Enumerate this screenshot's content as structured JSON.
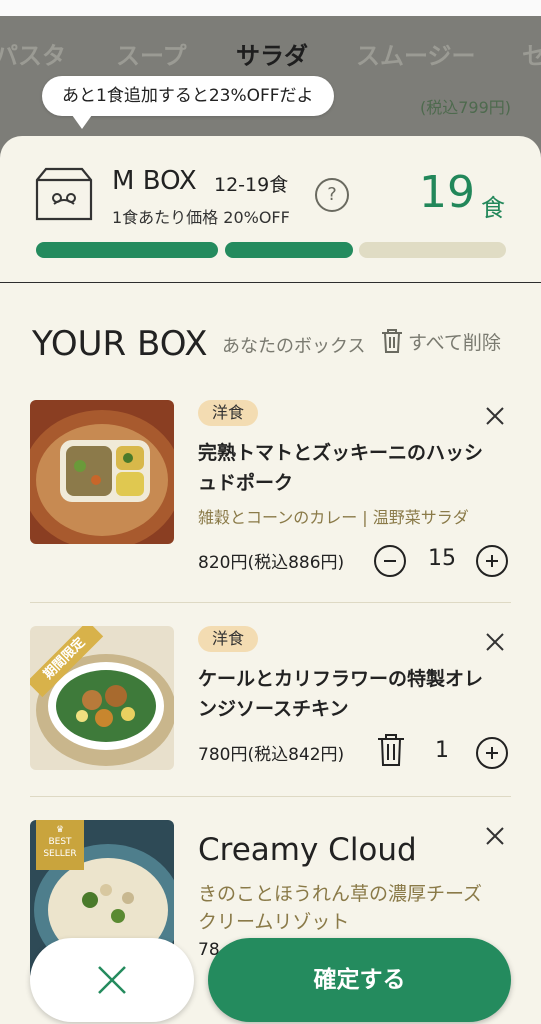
{
  "tabs": [
    "パスタ",
    "スープ",
    "サラダ",
    "スムージー",
    "セ"
  ],
  "bg_price": "(税込799円)",
  "tooltip": "あと1食追加すると23%OFFだよ",
  "box": {
    "name": "M BOX",
    "range": "12-19食",
    "discount": "1食あたり価格 20%OFF",
    "help": "?",
    "count": "19",
    "count_unit": "食",
    "progress_fraction": 0.67
  },
  "your_box": {
    "title": "YOUR BOX",
    "subtitle": "あなたのボックス",
    "delete_all": "すべて削除"
  },
  "items": [
    {
      "tag": "洋食",
      "name": "完熟トマトとズッキーニのハッシュドポーク",
      "sides": "雑穀とコーンのカレー | 温野菜サラダ",
      "price": "820円(税込886円)",
      "qty": "15"
    },
    {
      "tag": "洋食",
      "badge": "期間限定",
      "name": "ケールとカリフラワーの特製オレンジソースチキン",
      "price": "780円(税込842円)",
      "qty": "1"
    },
    {
      "badge_top": "BEST",
      "badge_bottom": "SELLER",
      "name": "Creamy Cloud",
      "subtitle": "きのことほうれん草の濃厚チーズクリームリゾット",
      "price_partial": "78"
    }
  ],
  "footer": {
    "confirm": "確定する"
  },
  "colors": {
    "accent": "#248b5e",
    "sheet": "#f6f4ea",
    "tag": "#f3dcb2"
  }
}
